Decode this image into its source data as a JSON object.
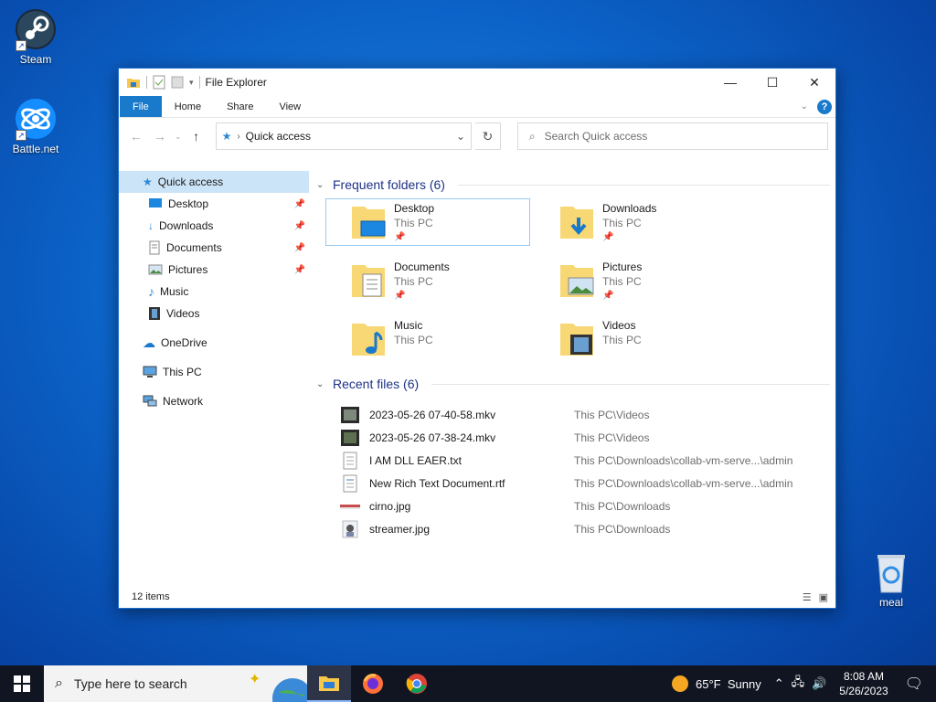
{
  "desktop": {
    "icons": [
      {
        "label": "Steam"
      },
      {
        "label": "Battle.net"
      },
      {
        "label": "meal"
      }
    ]
  },
  "window": {
    "title": "File Explorer",
    "tabs": [
      "File",
      "Home",
      "Share",
      "View"
    ],
    "address": "Quick access",
    "search_placeholder": "Search Quick access",
    "status_items": "12 items"
  },
  "sidebar": {
    "items": [
      {
        "label": "Quick access",
        "icon": "star-icon"
      },
      {
        "label": "Desktop",
        "icon": "desktop-icon",
        "pinned": true
      },
      {
        "label": "Downloads",
        "icon": "download-arrow-icon",
        "pinned": true
      },
      {
        "label": "Documents",
        "icon": "document-icon",
        "pinned": true
      },
      {
        "label": "Pictures",
        "icon": "picture-icon",
        "pinned": true
      },
      {
        "label": "Music",
        "icon": "music-note-icon"
      },
      {
        "label": "Videos",
        "icon": "film-icon"
      },
      {
        "label": "OneDrive",
        "icon": "cloud-icon"
      },
      {
        "label": "This PC",
        "icon": "monitor-icon"
      },
      {
        "label": "Network",
        "icon": "network-icon"
      }
    ]
  },
  "frequent": {
    "header": "Frequent folders (6)",
    "folders": [
      {
        "name": "Desktop",
        "location": "This PC",
        "pinned": true
      },
      {
        "name": "Downloads",
        "location": "This PC",
        "pinned": true
      },
      {
        "name": "Documents",
        "location": "This PC",
        "pinned": true
      },
      {
        "name": "Pictures",
        "location": "This PC",
        "pinned": true
      },
      {
        "name": "Music",
        "location": "This PC",
        "pinned": false
      },
      {
        "name": "Videos",
        "location": "This PC",
        "pinned": false
      }
    ]
  },
  "recent": {
    "header": "Recent files (6)",
    "files": [
      {
        "name": "2023-05-26 07-40-58.mkv",
        "path": "This PC\\Videos"
      },
      {
        "name": "2023-05-26 07-38-24.mkv",
        "path": "This PC\\Videos"
      },
      {
        "name": "I AM DLL EAER.txt",
        "path": "This PC\\Downloads\\collab-vm-serve...\\admin"
      },
      {
        "name": "New Rich Text Document.rtf",
        "path": "This PC\\Downloads\\collab-vm-serve...\\admin"
      },
      {
        "name": "cirno.jpg",
        "path": "This PC\\Downloads"
      },
      {
        "name": "streamer.jpg",
        "path": "This PC\\Downloads"
      }
    ]
  },
  "taskbar": {
    "search_placeholder": "Type here to search",
    "weather": "65°F  Sunny",
    "time": "8:08 AM",
    "date": "5/26/2023"
  },
  "colors": {
    "accent": "#1979ca",
    "selection": "#cce4f7",
    "folder_yellow": "#f8d775"
  }
}
